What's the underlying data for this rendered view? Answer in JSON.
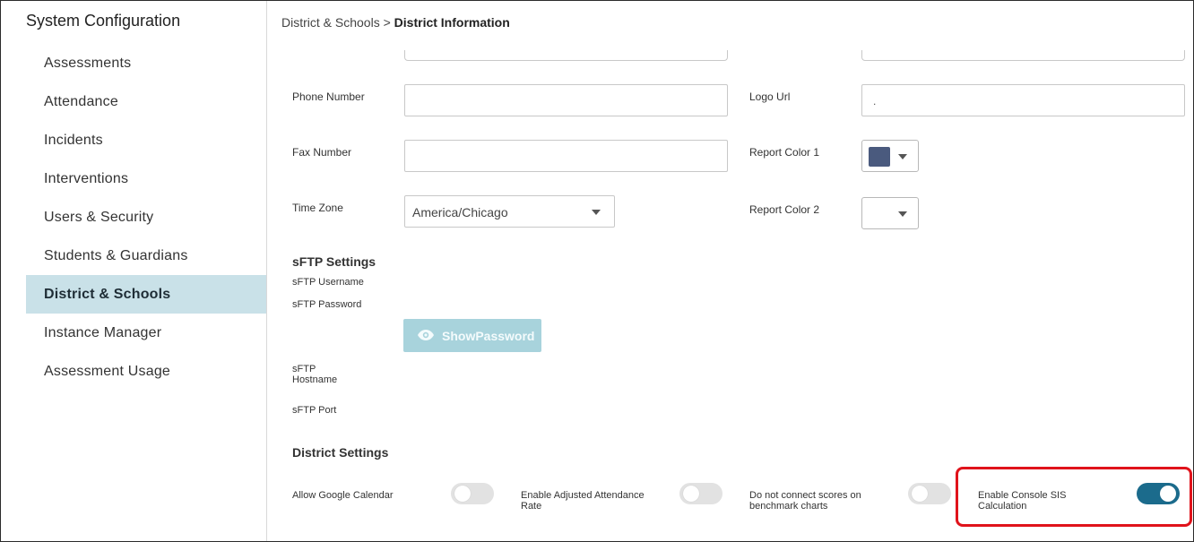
{
  "sidebar": {
    "title": "System Configuration",
    "items": [
      {
        "label": "Assessments"
      },
      {
        "label": "Attendance"
      },
      {
        "label": "Incidents"
      },
      {
        "label": "Interventions"
      },
      {
        "label": "Users & Security"
      },
      {
        "label": "Students & Guardians"
      },
      {
        "label": "District & Schools",
        "active": true
      },
      {
        "label": "Instance Manager"
      },
      {
        "label": "Assessment Usage"
      }
    ]
  },
  "breadcrumb": {
    "parent": "District & Schools",
    "separator": ">",
    "current": "District Information"
  },
  "form": {
    "phone_label": "Phone Number",
    "phone_value": "",
    "fax_label": "Fax Number",
    "fax_value": "",
    "timezone_label": "Time Zone",
    "timezone_value": "America/Chicago",
    "logo_label": "Logo Url",
    "logo_value": ".",
    "report_color1_label": "Report Color 1",
    "report_color1_value": "#4a5a7e",
    "report_color2_label": "Report Color 2",
    "report_color2_value": "#ffffff"
  },
  "sftp": {
    "title": "sFTP Settings",
    "username_label": "sFTP Username",
    "password_label": "sFTP Password",
    "show_password_label": "ShowPassword",
    "hostname_label_line1": "sFTP",
    "hostname_label_line2": "Hostname",
    "port_label": "sFTP Port"
  },
  "district_settings": {
    "title": "District Settings",
    "toggles": [
      {
        "label_line1": "Allow Google Calendar",
        "label_line2": "",
        "on": false
      },
      {
        "label_line1": "Enable Adjusted Attendance",
        "label_line2": "Rate",
        "on": false
      },
      {
        "label_line1": "Do not connect scores on",
        "label_line2": "benchmark charts",
        "on": false
      },
      {
        "label_line1": "Enable Console SIS",
        "label_line2": "Calculation",
        "on": true
      }
    ]
  },
  "colors": {
    "accent": "#1b6b8c",
    "active_nav": "#c9e1e8",
    "button_disabled": "#a8d3dc",
    "highlight": "#e0131b"
  }
}
